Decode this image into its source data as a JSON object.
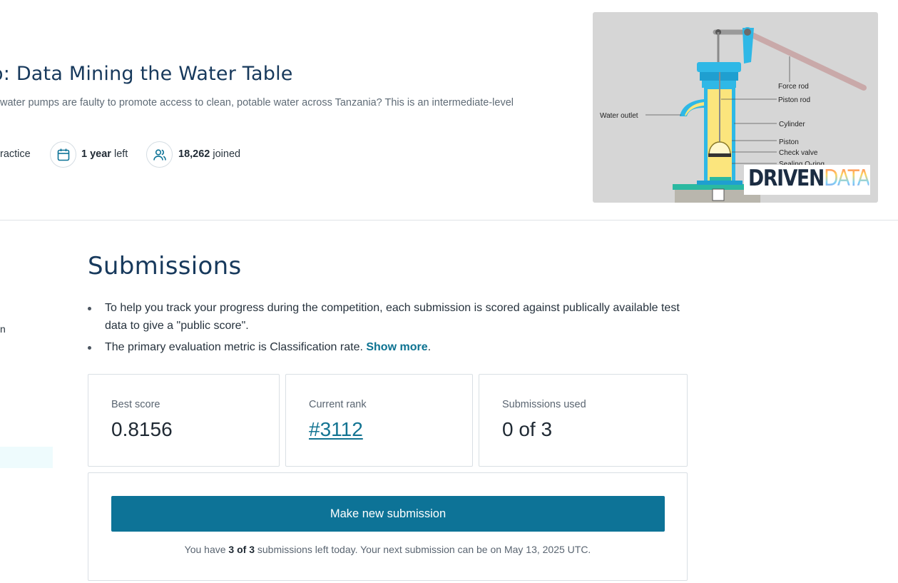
{
  "competition": {
    "title": ": Data Mining the Water Table",
    "title_prefix_glyph": "o",
    "subtitle": "water pumps are faulty to promote access to clean, potable water across Tanzania? This is an intermediate-level",
    "meta": {
      "type_label": "ractice",
      "time_value": "1 year",
      "time_suffix": "left",
      "joined_value": "18,262",
      "joined_suffix": "joined"
    },
    "banner": {
      "labels": [
        "Force rod",
        "Piston rod",
        "Water outlet",
        "Cylinder",
        "Piston",
        "Check valve",
        "Sealing O-ring"
      ],
      "brand_drive": "DRIVEN",
      "brand_data": "DATA"
    }
  },
  "sidebar": {
    "partial_glyph": "n"
  },
  "submissions": {
    "heading": "Submissions",
    "bullets": {
      "first": "To help you track your progress during the competition, each submission is scored against publically available test data to give a \"public score\".",
      "second_prefix": "The primary evaluation metric is Classification rate. ",
      "show_more": "Show more",
      "second_suffix": "."
    },
    "stats": {
      "best_score_label": "Best score",
      "best_score_value": "0.8156",
      "rank_label": "Current rank",
      "rank_value": "#3112",
      "used_label": "Submissions used",
      "used_value": "0 of 3"
    },
    "submit_button": "Make new submission",
    "note": {
      "prefix": "You have ",
      "count": "3 of 3",
      "suffix": " submissions left today. Your next submission can be on May 13, 2025 UTC."
    }
  },
  "colors": {
    "accent": "#0d7397",
    "heading": "#17395c",
    "link": "#137492"
  }
}
